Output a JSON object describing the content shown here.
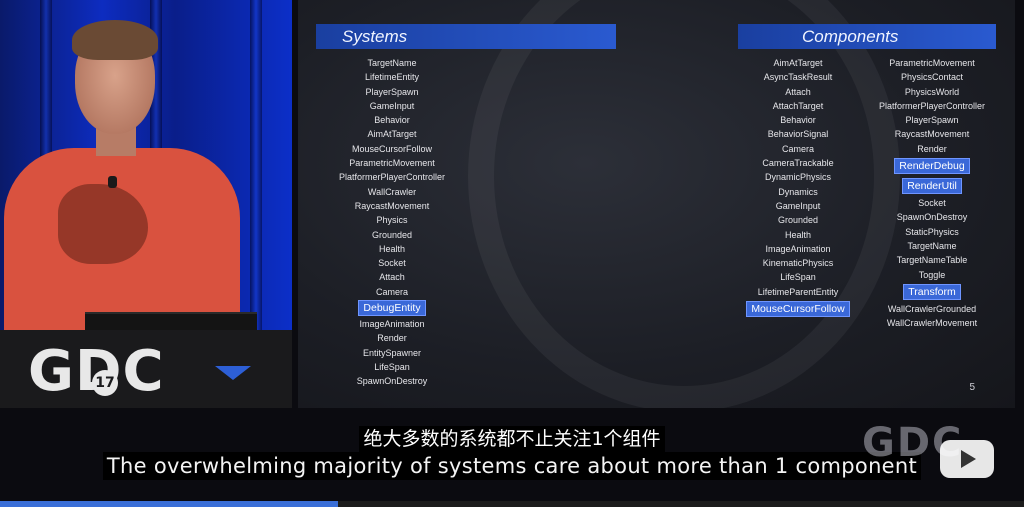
{
  "slide": {
    "systems_header": "Systems",
    "components_header": "Components",
    "page_number": "5",
    "systems": [
      {
        "label": "TargetName"
      },
      {
        "label": "LifetimeEntity"
      },
      {
        "label": "PlayerSpawn"
      },
      {
        "label": "GameInput"
      },
      {
        "label": "Behavior"
      },
      {
        "label": "AimAtTarget"
      },
      {
        "label": "MouseCursorFollow"
      },
      {
        "label": "ParametricMovement"
      },
      {
        "label": "PlatformerPlayerController"
      },
      {
        "label": "WallCrawler"
      },
      {
        "label": "RaycastMovement"
      },
      {
        "label": "Physics"
      },
      {
        "label": "Grounded"
      },
      {
        "label": "Health"
      },
      {
        "label": "Socket"
      },
      {
        "label": "Attach"
      },
      {
        "label": "Camera"
      },
      {
        "label": "DebugEntity",
        "highlighted": true
      },
      {
        "label": "ImageAnimation"
      },
      {
        "label": "Render"
      },
      {
        "label": "EntitySpawner"
      },
      {
        "label": "LifeSpan"
      },
      {
        "label": "SpawnOnDestroy"
      }
    ],
    "components_left": [
      {
        "label": "AimAtTarget"
      },
      {
        "label": "AsyncTaskResult"
      },
      {
        "label": "Attach"
      },
      {
        "label": "AttachTarget"
      },
      {
        "label": "Behavior"
      },
      {
        "label": "BehaviorSignal"
      },
      {
        "label": "Camera"
      },
      {
        "label": "CameraTrackable"
      },
      {
        "label": "DynamicPhysics"
      },
      {
        "label": "Dynamics"
      },
      {
        "label": "GameInput"
      },
      {
        "label": "Grounded"
      },
      {
        "label": "Health"
      },
      {
        "label": "ImageAnimation"
      },
      {
        "label": "KinematicPhysics"
      },
      {
        "label": "LifeSpan"
      },
      {
        "label": "LifetimeParentEntity"
      },
      {
        "label": "MouseCursorFollow",
        "highlighted": true
      }
    ],
    "components_right": [
      {
        "label": "ParametricMovement"
      },
      {
        "label": "PhysicsContact"
      },
      {
        "label": "PhysicsWorld"
      },
      {
        "label": "PlatformerPlayerController"
      },
      {
        "label": "PlayerSpawn"
      },
      {
        "label": "RaycastMovement"
      },
      {
        "label": "Render"
      },
      {
        "label": "RenderDebug",
        "highlighted": true
      },
      {
        "label": "RenderUtil",
        "highlighted": true
      },
      {
        "label": "Socket"
      },
      {
        "label": "SpawnOnDestroy"
      },
      {
        "label": "StaticPhysics"
      },
      {
        "label": "TargetName"
      },
      {
        "label": "TargetNameTable"
      },
      {
        "label": "Toggle"
      },
      {
        "label": "Transform",
        "highlighted": true
      },
      {
        "label": "WallCrawlerGrounded"
      },
      {
        "label": "WallCrawlerMovement"
      }
    ]
  },
  "stage": {
    "logo_text": "GDC",
    "logo_year": "17"
  },
  "subtitles": {
    "chinese": "绝大多数的系统都不止关注1个组件",
    "english": "The overwhelming majority of systems care about more than 1 component"
  },
  "player": {
    "watermark": "GDC",
    "play_icon": "play-icon",
    "progress_fraction": 0.33
  },
  "colors": {
    "highlight": "#3a68d8",
    "header_bar": "#2a5ad0",
    "curtain": "#0d2cc0",
    "shirt": "#d9523f"
  }
}
